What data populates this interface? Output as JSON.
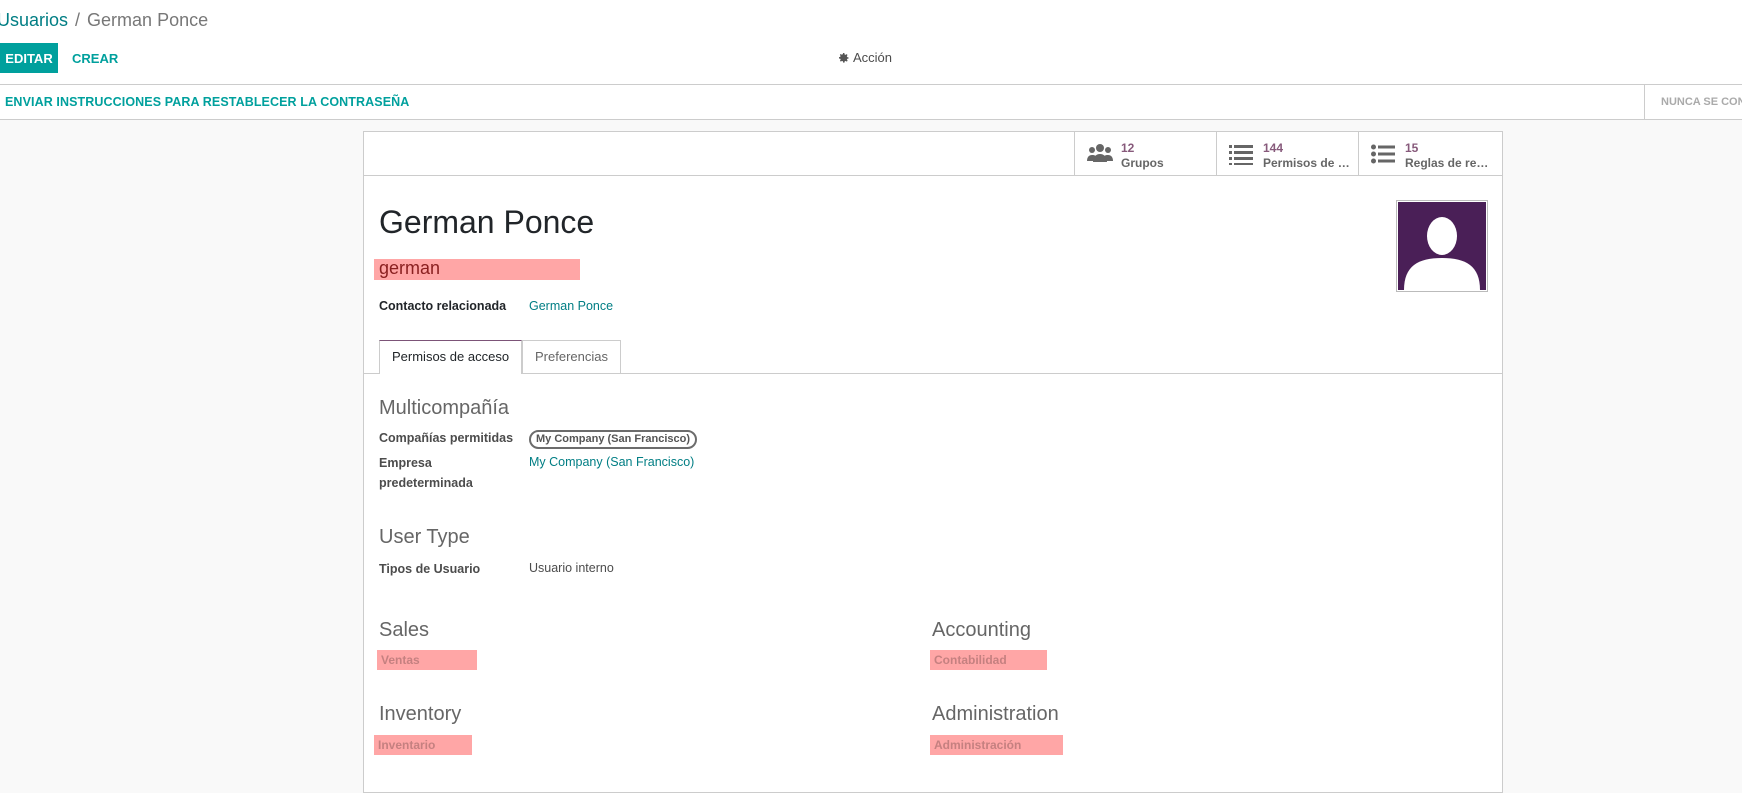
{
  "breadcrumb": {
    "parent": "Usuarios",
    "separator": "/",
    "current": "German Ponce"
  },
  "toolbar": {
    "edit_label": "EDITAR",
    "create_label": "CREAR",
    "action_label": "Acción"
  },
  "statusbar": {
    "reset_password_label": "ENVIAR INSTRUCCIONES PARA RESTABLECER LA CONTRASEÑA",
    "never_connected_label": "NUNCA SE CONECTÓ"
  },
  "smart_buttons": [
    {
      "icon": "users-icon",
      "count": "12",
      "label": "Grupos"
    },
    {
      "icon": "list-icon",
      "count": "144",
      "label": "Permisos de acceso"
    },
    {
      "icon": "list-ul-icon",
      "count": "15",
      "label": "Reglas de registro"
    }
  ],
  "user": {
    "name": "German Ponce",
    "login": "german",
    "related_contact_label": "Contacto relacionada",
    "related_contact_value": "German Ponce"
  },
  "tabs": [
    {
      "label": "Permisos de acceso",
      "active": true
    },
    {
      "label": "Preferencias",
      "active": false
    }
  ],
  "multicompany": {
    "title": "Multicompañía",
    "allowed_label": "Compañías permitidas",
    "allowed_value": "My Company (San Francisco)",
    "default_label_1": "Empresa",
    "default_label_2": "predeterminada",
    "default_value": "My Company (San Francisco)"
  },
  "user_type": {
    "title": "User Type",
    "label": "Tipos de Usuario",
    "value": "Usuario interno"
  },
  "apps": {
    "sales": {
      "title": "Sales",
      "label": "Ventas"
    },
    "accounting": {
      "title": "Accounting",
      "label": "Contabilidad"
    },
    "inventory": {
      "title": "Inventory",
      "label": "Inventario"
    },
    "administration": {
      "title": "Administration",
      "label": "Administración"
    }
  },
  "colors": {
    "primary": "#00a09d",
    "link": "#017e84",
    "accent": "#875a7b",
    "avatar_bg": "#4a1f57",
    "redaction": "#ffa6a6"
  }
}
